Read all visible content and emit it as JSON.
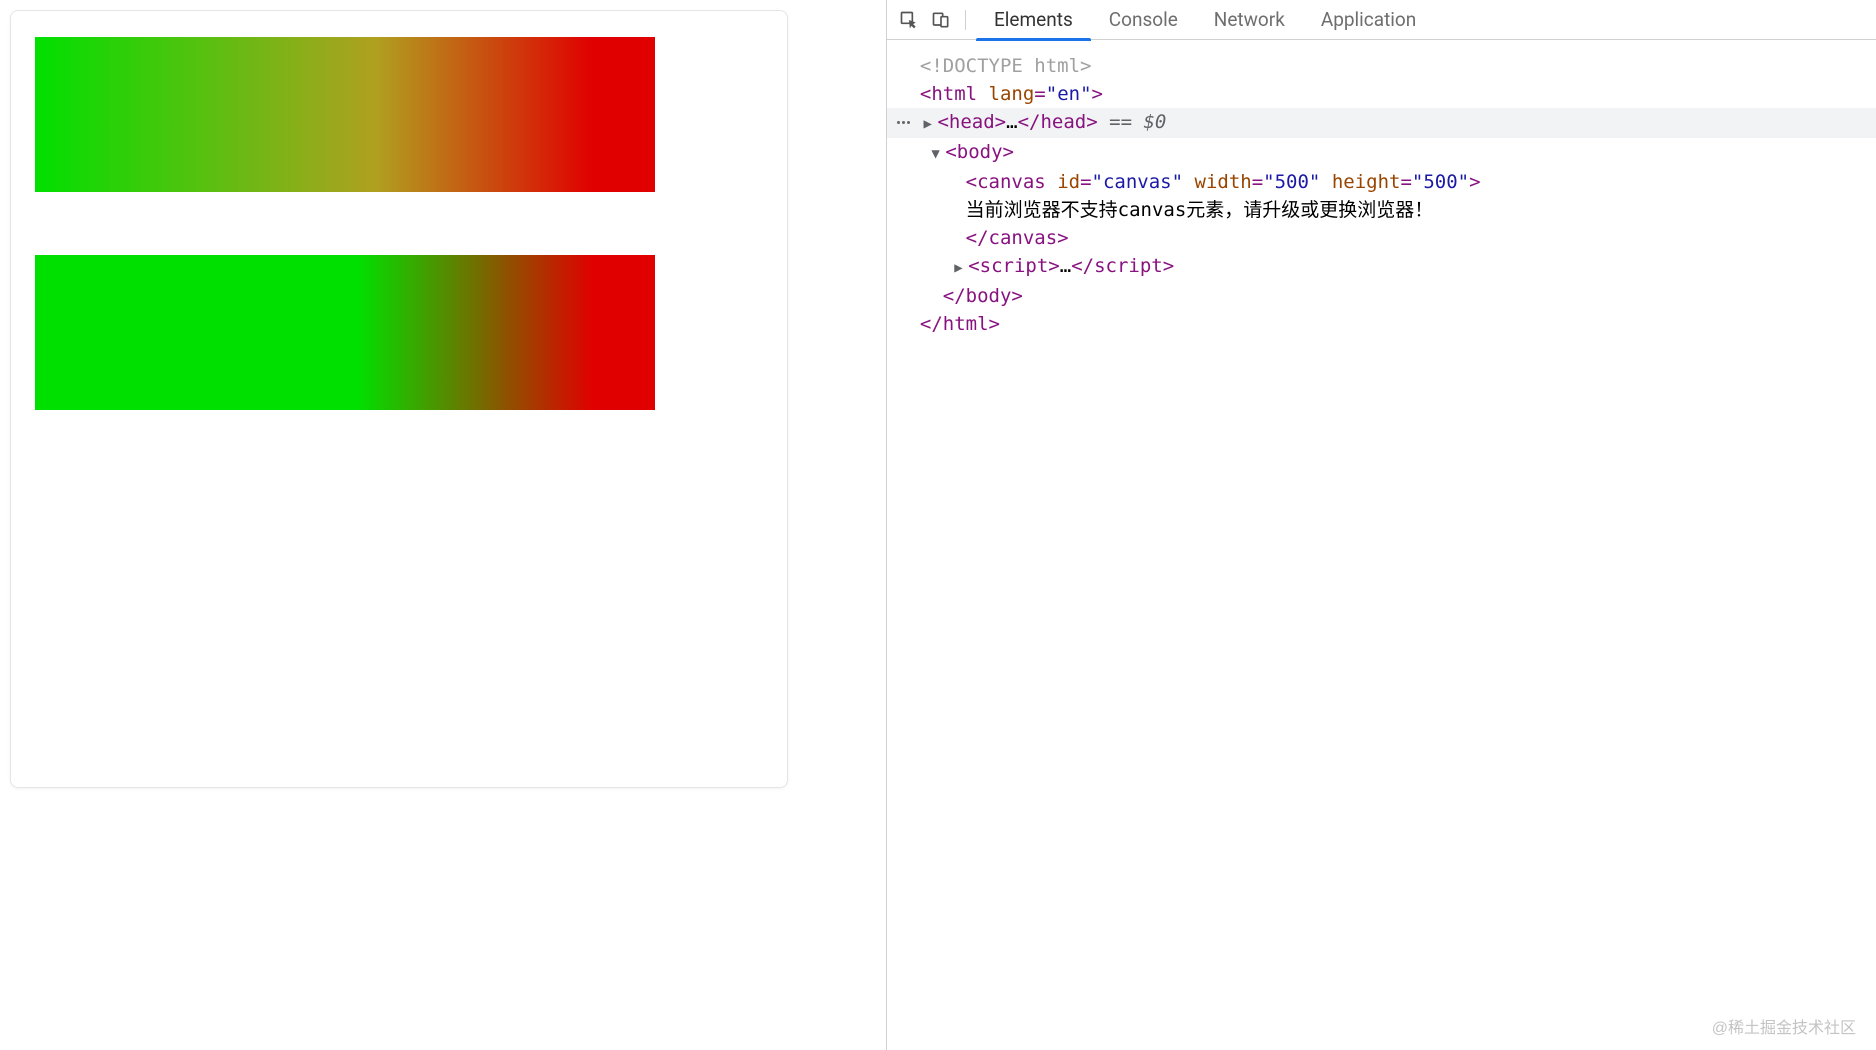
{
  "devtools": {
    "tabs": {
      "elements": "Elements",
      "console": "Console",
      "network": "Network",
      "application": "Application"
    },
    "selection_marker": "== $0"
  },
  "dom": {
    "doctype": "<!DOCTYPE html>",
    "html_open": "<",
    "html_tag": "html",
    "lang_attr": "lang",
    "lang_val": "\"en\"",
    "head": "head",
    "head_ellipsis": "…",
    "body": "body",
    "canvas": "canvas",
    "canvas_id_attr": "id",
    "canvas_id_val": "\"canvas\"",
    "canvas_width_attr": "width",
    "canvas_width_val": "\"500\"",
    "canvas_height_attr": "height",
    "canvas_height_val": "\"500\"",
    "canvas_fallback": "当前浏览器不支持canvas元素，请升级或更换浏览器！",
    "script": "script",
    "script_ellipsis": "…",
    "close": ">"
  },
  "watermark": "@稀土掘金技术社区"
}
